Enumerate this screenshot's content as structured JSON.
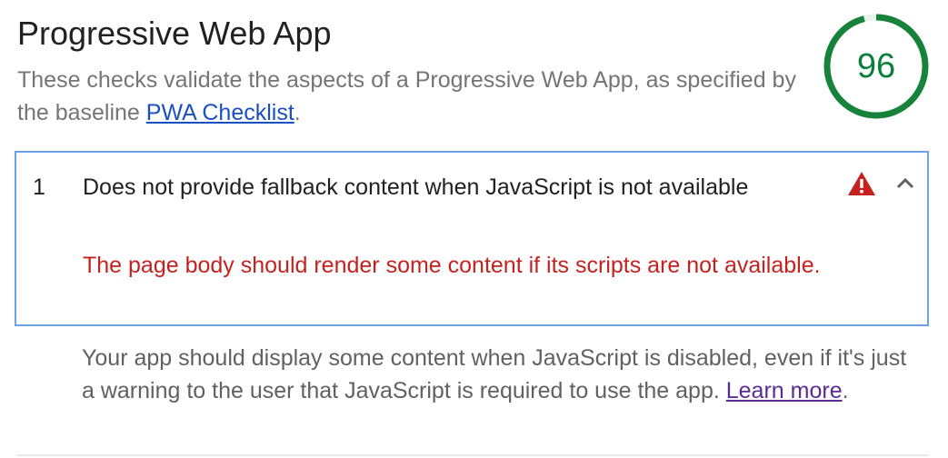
{
  "category": {
    "title": "Progressive Web App",
    "description_prefix": "These checks validate the aspects of a Progressive Web App, as specified by the baseline ",
    "description_link": "PWA Checklist",
    "description_suffix": ".",
    "score": "96",
    "score_fraction": 0.96,
    "score_color": "#178239"
  },
  "audit": {
    "index": "1",
    "title": "Does not provide fallback content when JavaScript is not available",
    "error": "The page body should render some content if its scripts are not available.",
    "status_icon": "warning-triangle-icon",
    "expand_icon": "chevron-up-icon",
    "warning_color": "#c5221f",
    "details_text": "Your app should display some content when JavaScript is disabled, even if it's just a warning to the user that JavaScript is required to use the app. ",
    "details_link": "Learn more",
    "details_suffix": "."
  }
}
